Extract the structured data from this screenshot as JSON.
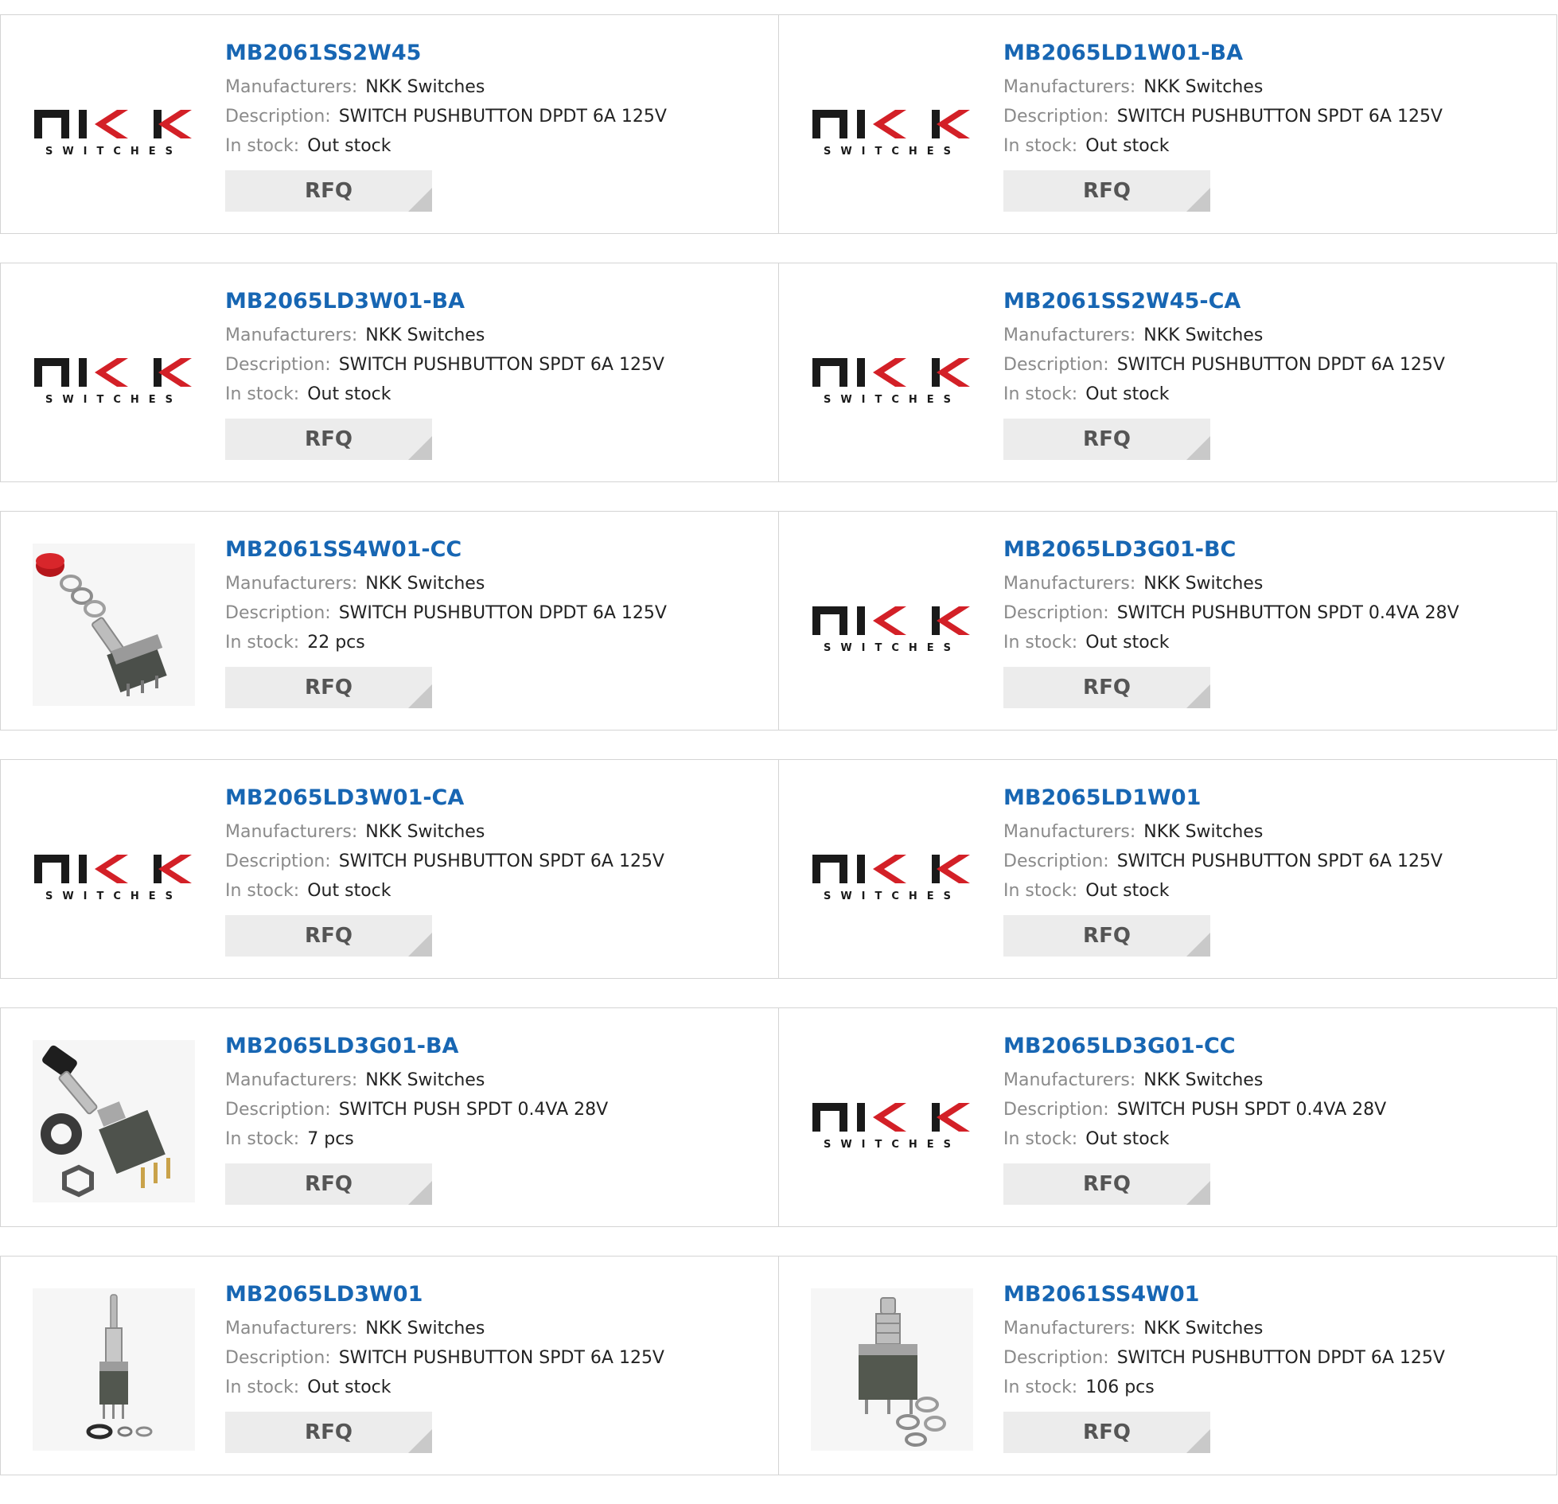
{
  "labels": {
    "manufacturer": "Manufacturers:",
    "description": "Description:",
    "stock": "In stock:",
    "rfq": "RFQ"
  },
  "colors": {
    "part_link": "#1766b3",
    "label_gray": "#8a8a8a",
    "rfq_bg": "#ececec",
    "logo_red": "#d32027",
    "logo_black": "#1a1a1a"
  },
  "logo": {
    "wordmark": "nkk",
    "subtitle": "SWITCHES"
  },
  "products": [
    {
      "part": "MB2061SS2W45",
      "manufacturer": "NKK Switches",
      "description": "SWITCH PUSHBUTTON DPDT 6A 125V",
      "stock": "Out stock",
      "image": "nkk-logo"
    },
    {
      "part": "MB2065LD1W01-BA",
      "manufacturer": "NKK Switches",
      "description": "SWITCH PUSHBUTTON SPDT 6A 125V",
      "stock": "Out stock",
      "image": "nkk-logo"
    },
    {
      "part": "MB2065LD3W01-BA",
      "manufacturer": "NKK Switches",
      "description": "SWITCH PUSHBUTTON SPDT 6A 125V",
      "stock": "Out stock",
      "image": "nkk-logo"
    },
    {
      "part": "MB2061SS2W45-CA",
      "manufacturer": "NKK Switches",
      "description": "SWITCH PUSHBUTTON DPDT 6A 125V",
      "stock": "Out stock",
      "image": "nkk-logo"
    },
    {
      "part": "MB2061SS4W01-CC",
      "manufacturer": "NKK Switches",
      "description": "SWITCH PUSHBUTTON DPDT 6A 125V",
      "stock": "22 pcs",
      "image": "switch-red-cap-photo"
    },
    {
      "part": "MB2065LD3G01-BC",
      "manufacturer": "NKK Switches",
      "description": "SWITCH PUSHBUTTON SPDT 0.4VA 28V",
      "stock": "Out stock",
      "image": "nkk-logo"
    },
    {
      "part": "MB2065LD3W01-CA",
      "manufacturer": "NKK Switches",
      "description": "SWITCH PUSHBUTTON SPDT 6A 125V",
      "stock": "Out stock",
      "image": "nkk-logo"
    },
    {
      "part": "MB2065LD1W01",
      "manufacturer": "NKK Switches",
      "description": "SWITCH PUSHBUTTON SPDT 6A 125V",
      "stock": "Out stock",
      "image": "nkk-logo"
    },
    {
      "part": "MB2065LD3G01-BA",
      "manufacturer": "NKK Switches",
      "description": "SWITCH PUSH SPDT 0.4VA 28V",
      "stock": "7 pcs",
      "image": "switch-black-cap-photo"
    },
    {
      "part": "MB2065LD3G01-CC",
      "manufacturer": "NKK Switches",
      "description": "SWITCH PUSH SPDT 0.4VA 28V",
      "stock": "Out stock",
      "image": "nkk-logo"
    },
    {
      "part": "MB2065LD3W01",
      "manufacturer": "NKK Switches",
      "description": "SWITCH PUSHBUTTON SPDT 6A 125V",
      "stock": "Out stock",
      "image": "switch-slim-photo"
    },
    {
      "part": "MB2061SS4W01",
      "manufacturer": "NKK Switches",
      "description": "SWITCH PUSHBUTTON DPDT 6A 125V",
      "stock": "106 pcs",
      "image": "switch-square-photo"
    }
  ]
}
